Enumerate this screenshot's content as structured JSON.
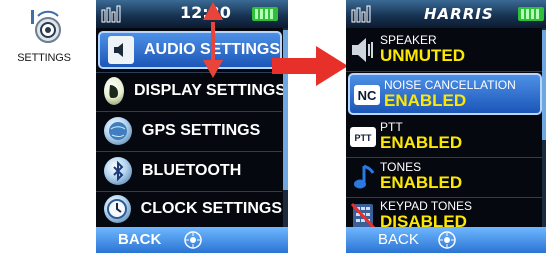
{
  "launcher": {
    "label": "SETTINGS",
    "icon": "settings-gear-icon"
  },
  "left_screen": {
    "status": {
      "time": "12:30"
    },
    "menu": [
      {
        "label": "AUDIO SETTINGS",
        "icon": "speaker-icon",
        "selected": true
      },
      {
        "label": "DISPLAY SETTINGS",
        "icon": "display-icon"
      },
      {
        "label": "GPS SETTINGS",
        "icon": "globe-icon"
      },
      {
        "label": "BLUETOOTH",
        "icon": "bluetooth-icon"
      },
      {
        "label": "CLOCK SETTINGS",
        "icon": "clock-icon"
      }
    ],
    "bottom": {
      "back": "BACK"
    }
  },
  "right_screen": {
    "status": {
      "brand": "HARRIS"
    },
    "items": [
      {
        "title": "SPEAKER",
        "value": "UNMUTED",
        "icon": "speaker-icon"
      },
      {
        "title": "NOISE CANCELLATION",
        "value": "ENABLED",
        "icon": "nc-icon",
        "icon_text": "NC",
        "selected": true
      },
      {
        "title": "PTT",
        "value": "ENABLED",
        "icon": "ptt-icon",
        "icon_text": "PTT"
      },
      {
        "title": "TONES",
        "value": "ENABLED",
        "icon": "music-note-icon"
      },
      {
        "title": "KEYPAD TONES",
        "value": "DISABLED",
        "icon": "keypad-muted-icon"
      }
    ],
    "bottom": {
      "back": "BACK"
    }
  },
  "colors": {
    "highlight": "#2a6fd6",
    "value_yellow": "#ffe800",
    "arrow_red": "#e8302a",
    "bar_blue": "#3d8ae6"
  }
}
